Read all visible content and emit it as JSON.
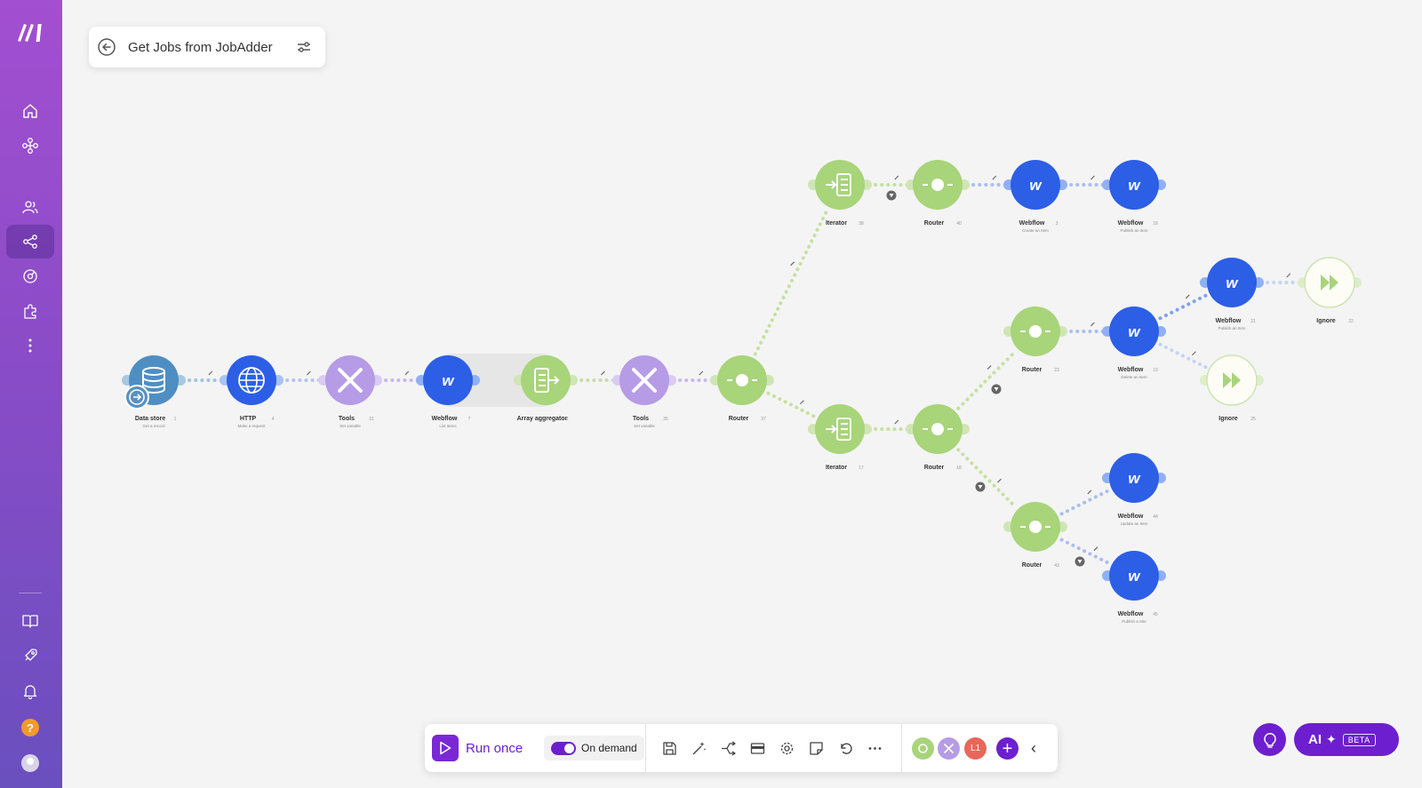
{
  "app": {
    "colors": {
      "sidebar_top": "#a24fd1",
      "sidebar_bottom": "#6a4fbf",
      "accent": "#6d1fcf",
      "webflow": "#2c5fe6",
      "router": "#a8d47a",
      "tools": "#b69be6",
      "datastore": "#4f8ec2"
    }
  },
  "sidebar": {
    "items": [
      {
        "name": "home-icon"
      },
      {
        "name": "templates-icon"
      },
      {
        "name": "team-icon"
      },
      {
        "name": "scenarios-icon",
        "active": true
      },
      {
        "name": "connections-icon"
      },
      {
        "name": "apps-icon"
      },
      {
        "name": "more-icon"
      },
      {
        "name": "docs-icon"
      },
      {
        "name": "whats-new-icon"
      },
      {
        "name": "notifications-icon"
      },
      {
        "name": "help-icon"
      },
      {
        "name": "profile-icon"
      }
    ]
  },
  "header": {
    "title": "Get Jobs from JobAdder",
    "back_icon": "back-arrow-icon",
    "settings_icon": "sliders-icon"
  },
  "nodes": [
    {
      "id": "datastore",
      "label": "Data store",
      "num": "1",
      "sub": "Get a record"
    },
    {
      "id": "http",
      "label": "HTTP",
      "num": "4",
      "sub": "Make a request"
    },
    {
      "id": "tools1",
      "label": "Tools",
      "num": "31",
      "sub": "Set variable"
    },
    {
      "id": "wf-list",
      "label": "Webflow",
      "num": "7",
      "sub": "List Items"
    },
    {
      "id": "aggregator",
      "label": "Array aggregator",
      "num": "8",
      "sub": ""
    },
    {
      "id": "tools2",
      "label": "Tools",
      "num": "35",
      "sub": "Set variable"
    },
    {
      "id": "router1",
      "label": "Router",
      "num": "37",
      "sub": ""
    },
    {
      "id": "iter-top",
      "label": "Iterator",
      "num": "38",
      "sub": ""
    },
    {
      "id": "router-top",
      "label": "Router",
      "num": "40",
      "sub": ""
    },
    {
      "id": "wf-create",
      "label": "Webflow",
      "num": "3",
      "sub": "Create an Item"
    },
    {
      "id": "wf-publish1",
      "label": "Webflow",
      "num": "18",
      "sub": "Publish an Item"
    },
    {
      "id": "iter-bot",
      "label": "Iterator",
      "num": "17",
      "sub": ""
    },
    {
      "id": "router-mid",
      "label": "Router",
      "num": "18",
      "sub": ""
    },
    {
      "id": "router-upper",
      "label": "Router",
      "num": "23",
      "sub": ""
    },
    {
      "id": "wf-delete",
      "label": "Webflow",
      "num": "19",
      "sub": "Delete an Item"
    },
    {
      "id": "wf-publish2",
      "label": "Webflow",
      "num": "21",
      "sub": "Publish an Item"
    },
    {
      "id": "ignore1",
      "label": "Ignore",
      "num": "22",
      "sub": ""
    },
    {
      "id": "ignore2",
      "label": "Ignore",
      "num": "25",
      "sub": ""
    },
    {
      "id": "router-lower",
      "label": "Router",
      "num": "43",
      "sub": ""
    },
    {
      "id": "wf-update",
      "label": "Webflow",
      "num": "44",
      "sub": "Update an Item"
    },
    {
      "id": "wf-publish3",
      "label": "Webflow",
      "num": "45",
      "sub": "Publish a Site"
    }
  ],
  "toolbar": {
    "run_label": "Run once",
    "schedule_label": "On demand",
    "schedule_on": true,
    "tools": [
      "save-icon",
      "auto-align-icon",
      "explain-flow-icon",
      "notes-icon",
      "settings-icon",
      "sticky-note-icon",
      "undo-icon",
      "more-icon"
    ],
    "apps_used": [
      {
        "name": "router-app",
        "color": "#a8d47a",
        "text": ""
      },
      {
        "name": "tools-app",
        "color": "#b69be6",
        "text": ""
      },
      {
        "name": "custom-app",
        "color": "#e8675a",
        "text": "L1"
      }
    ]
  },
  "ai": {
    "label": "AI",
    "badge": "BETA"
  }
}
